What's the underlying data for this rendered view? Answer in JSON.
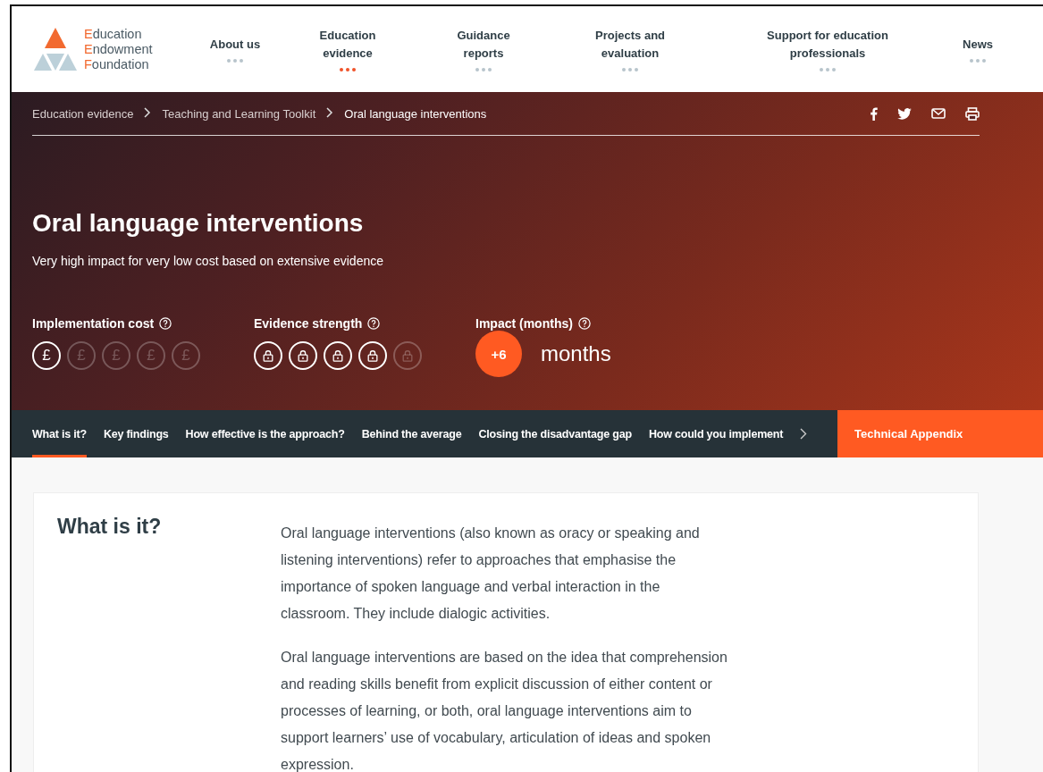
{
  "logo": {
    "lines": [
      "Education",
      "Endowment",
      "Foundation"
    ]
  },
  "nav": [
    {
      "label": "About us",
      "selected": false
    },
    {
      "label": "Education evidence",
      "selected": true
    },
    {
      "label": "Guidance reports",
      "selected": false
    },
    {
      "label": "Projects and evaluation",
      "selected": false
    },
    {
      "label": "Support for education professionals",
      "selected": false
    },
    {
      "label": "News",
      "selected": false
    }
  ],
  "breadcrumb": [
    "Education evidence",
    "Teaching and Learning Toolkit",
    "Oral language interventions"
  ],
  "title": "Oral language interventions",
  "subtitle": "Very high impact for very low cost based on extensive evidence",
  "metrics": [
    {
      "kind": "cost",
      "label": "Implementation cost",
      "icons": [
        {
          "symbol": "£",
          "active": true
        },
        {
          "symbol": "£",
          "active": false
        },
        {
          "symbol": "£",
          "active": false
        },
        {
          "symbol": "£",
          "active": false
        },
        {
          "symbol": "£",
          "active": false
        }
      ]
    },
    {
      "kind": "evidence",
      "label": "Evidence strength",
      "icons": [
        {
          "active": true
        },
        {
          "active": true
        },
        {
          "active": true
        },
        {
          "active": true
        },
        {
          "active": false
        }
      ]
    },
    {
      "kind": "impact",
      "label": "Impact (months)",
      "value": "+6",
      "unit": "months"
    }
  ],
  "tabs": [
    {
      "label": "What is it?",
      "selected": true
    },
    {
      "label": "Key findings",
      "selected": false
    },
    {
      "label": "How effective is the approach?",
      "selected": false
    },
    {
      "label": "Behind the average",
      "selected": false
    },
    {
      "label": "Closing the disadvantage gap",
      "selected": false
    },
    {
      "label": "How could you implement",
      "selected": false
    }
  ],
  "appendix_button": "Technical Appendix",
  "section": {
    "heading": "What is it?",
    "paragraphs": [
      "Oral language interventions (also known as oracy or speaking and listening interventions) refer to approaches that emphasise the importance of spoken language and verbal interaction in the classroom. They include dialogic activities.",
      "Oral language interventions are based on the idea that comprehension and reading skills benefit from explicit discussion of either content or processes of learning, or both, oral language interventions aim to support learners’ use of vocabulary, articulation of ideas and spoken expression."
    ]
  }
}
